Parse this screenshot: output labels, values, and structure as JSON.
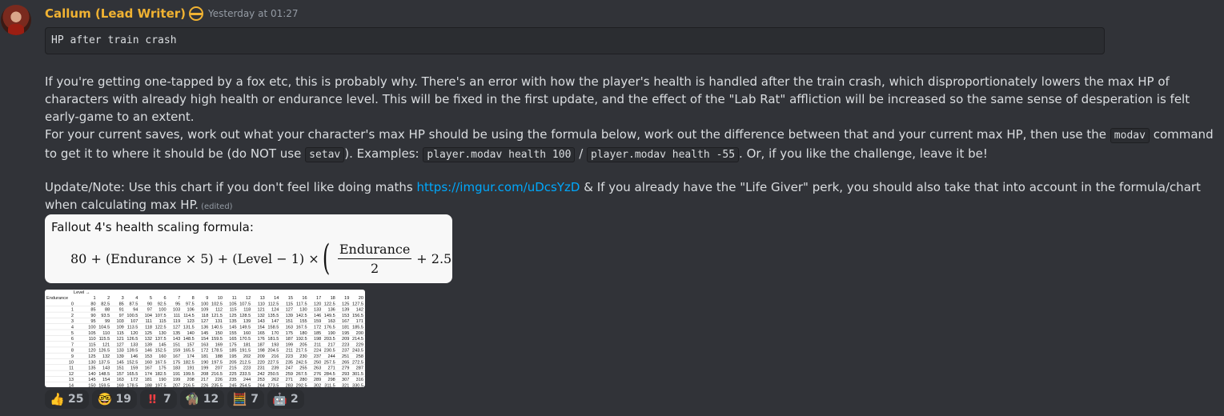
{
  "message": {
    "author": "Callum (Lead Writer)",
    "timestamp": "Yesterday at 01:27",
    "code_block": "HP after train crash",
    "paragraph1": "If you're getting one-tapped by a fox etc, this is probably why. There's an error with how the player's health is handled after the train crash, which disproportionately lowers the max HP of characters with already high health or endurance level. This will be fixed in the first update, and the effect of the \"Lab Rat\" affliction will be increased so the same sense of desperation is felt early-game to an extent.",
    "p2_part1": "For your current saves, work out what your character's max HP should be using the formula below, work out the difference between that and your current max HP, then use the",
    "p2_code1": "modav",
    "p2_part2": "command to get it to where it should be (do NOT use",
    "p2_code2": "setav",
    "p2_part3": "). Examples:",
    "p2_code3": "player.modav health 100",
    "p2_sep": "/",
    "p2_code4": "player.modav health -55",
    "p2_part4": ". Or, if you like the challenge, leave it be!",
    "p3_part1": "Update/Note: Use this chart if you don't feel like doing maths",
    "p3_link": "https://imgur.com/uDcsYzD",
    "p3_part2": "& If you already have the \"Life Giver\" perk, you should also take that into account in the formula/chart when calculating max HP.",
    "edited": "(edited)"
  },
  "formula_image": {
    "title": "Fallout 4's health scaling formula:",
    "left": "80 + (Endurance × 5) + (Level − 1) ×",
    "numerator": "Endurance",
    "denominator": "2",
    "right": "+ 2.5"
  },
  "table_image": {
    "col_header": "Level →",
    "row_header": "Endurance",
    "levels": [
      "1",
      "2",
      "3",
      "4",
      "5",
      "6",
      "7",
      "8",
      "9",
      "10",
      "11",
      "12",
      "13",
      "14",
      "15",
      "16",
      "17",
      "18",
      "19",
      "20"
    ],
    "endurance": [
      "0",
      "1",
      "2",
      "3",
      "4",
      "5",
      "6",
      "7",
      "8",
      "9",
      "10",
      "11",
      "12",
      "13",
      "14"
    ]
  },
  "reactions": [
    {
      "icon": "thumbs-up-icon",
      "glyph": "👍",
      "count": "25"
    },
    {
      "icon": "nerd-face-icon",
      "glyph": "🤓",
      "count": "19"
    },
    {
      "icon": "double-exclamation-icon",
      "glyph": "‼",
      "count": "7"
    },
    {
      "icon": "man-emoji-icon",
      "glyph": "🧌",
      "count": "12"
    },
    {
      "icon": "abacus-icon",
      "glyph": "🧮",
      "count": "7"
    },
    {
      "icon": "robot-icon",
      "glyph": "🤖",
      "count": "2"
    }
  ]
}
